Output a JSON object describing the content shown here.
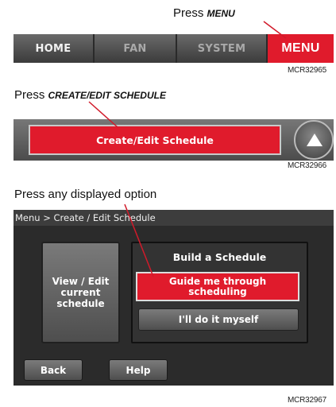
{
  "step1": {
    "instruction_prefix": "Press ",
    "instruction_key": "MENU",
    "tabs": {
      "home": "HOME",
      "fan": "FAN",
      "system": "SYSTEM",
      "menu": "MENU"
    },
    "figure_code": "MCR32965"
  },
  "step2": {
    "instruction_prefix": "Press ",
    "instruction_key": "CREATE/EDIT SCHEDULE",
    "button_label": "Create/Edit Schedule",
    "up_icon": "up-arrow-icon",
    "figure_code": "MCR32966"
  },
  "step3": {
    "instruction": "Press any displayed option",
    "breadcrumb": "Menu > Create / Edit Schedule",
    "view_edit_label": "View / Edit current schedule",
    "panel_title": "Build a Schedule",
    "guide_label": "Guide me through scheduling",
    "self_label": "I'll do it myself",
    "back_label": "Back",
    "help_label": "Help",
    "figure_code": "MCR32967"
  },
  "colors": {
    "accent_red": "#e01b2c",
    "button_gray": "#5e5e5e",
    "screen_bg": "#2b2b2b"
  }
}
